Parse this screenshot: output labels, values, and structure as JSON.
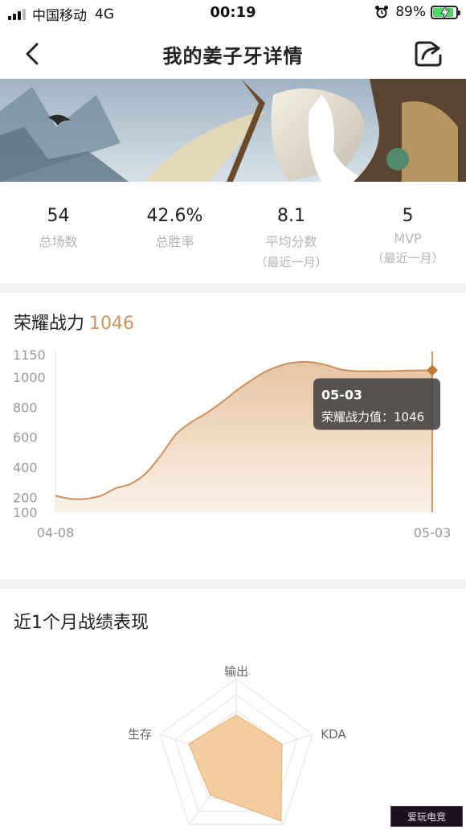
{
  "status_bar": {
    "carrier": "中国移动",
    "network": "4G",
    "time": "00:19",
    "battery": "89%",
    "battery_level": 0.89
  },
  "nav": {
    "title": "我的姜子牙详情"
  },
  "stats": [
    {
      "value": "54",
      "label": "总场数",
      "sub": ""
    },
    {
      "value": "42.6%",
      "label": "总胜率",
      "sub": ""
    },
    {
      "value": "8.1",
      "label": "平均分数",
      "sub": "（最近一月）"
    },
    {
      "value": "5",
      "label": "MVP",
      "sub": "（最近一月）"
    }
  ],
  "power": {
    "title": "荣耀战力",
    "value": "1046"
  },
  "chart_data": {
    "type": "area",
    "x_ticks": [
      "04-08",
      "05-03"
    ],
    "y_ticks": [
      100,
      200,
      400,
      600,
      800,
      1000,
      1150
    ],
    "ylim": [
      100,
      1150
    ],
    "x": [
      "04-08",
      "04-09",
      "04-10",
      "04-11",
      "04-12",
      "04-13",
      "04-14",
      "04-15",
      "04-16",
      "04-17",
      "04-18",
      "04-19",
      "04-20",
      "04-21",
      "04-22",
      "04-23",
      "04-24",
      "04-25",
      "04-26",
      "04-27",
      "04-28",
      "04-29",
      "04-30",
      "05-01",
      "05-02",
      "05-03"
    ],
    "values": [
      210,
      190,
      190,
      210,
      260,
      290,
      360,
      480,
      620,
      700,
      760,
      830,
      910,
      980,
      1040,
      1080,
      1100,
      1100,
      1080,
      1050,
      1040,
      1040,
      1040,
      1043,
      1045,
      1046
    ],
    "tooltip": {
      "date": "05-03",
      "label": "荣耀战力值：1046"
    },
    "colors": {
      "line": "#c89161",
      "fill_top": "#e6c4a3",
      "fill_bottom": "#fbf1e6",
      "marker": "#c07a36"
    }
  },
  "performance": {
    "title": "近1个月战绩表现",
    "radar_axes": [
      "输出",
      "KDA",
      "生存"
    ],
    "radar_color": "#f2c48e"
  },
  "watermark": "爱玩电竞"
}
